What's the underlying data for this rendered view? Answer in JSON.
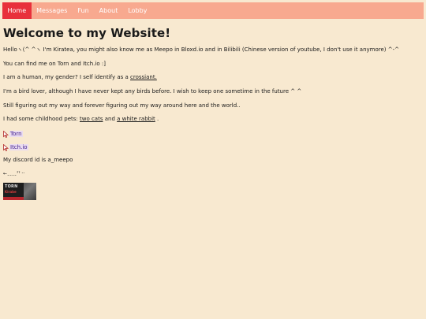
{
  "nav": {
    "items": [
      {
        "label": "Home",
        "active": true
      },
      {
        "label": "Messages",
        "active": false
      },
      {
        "label": "Fun",
        "active": false
      },
      {
        "label": "About",
        "active": false
      },
      {
        "label": "Lobby",
        "active": false
      }
    ]
  },
  "main": {
    "title": "Welcome to my Website!",
    "intro": "Helloヽ(^ ^ヽ I'm Kiratea, you might also know me as Meepo in Bloxd.io and in Bilibili (Chinese version of youtube, I don't use it anymore) ^-^",
    "find_me": "You can find me on Torn and Itch.io :]",
    "gender_prefix": "I am a human, my gender? I self identify as a ",
    "gender_link": "crossiant.",
    "bird_line": "I'm a bird lover, although I have never kept any birds before. I wish to keep one sometime in the future ^ ^",
    "figuring_line": "Still figuring out my way and forever figuring out my way around here and the world..",
    "pets_prefix": "I had some childhood pets: ",
    "pets_link_1": "two cats",
    "pets_mid": " and ",
    "pets_link_2": "a white rabbit",
    "pets_suffix": " .",
    "link_torn": "Torn",
    "link_itch": "Itch.io",
    "discord": "My discord id is a_meepo",
    "symbols": "←ˍˍˍˍˀˀ ˑˑ",
    "banner_title": "TORN",
    "banner_sub": "Kirabe"
  },
  "colors": {
    "background": "#f8e9d0",
    "navbar": "#f8a98f",
    "nav_active": "#e8303b",
    "link_highlight": "#eadcf0"
  }
}
